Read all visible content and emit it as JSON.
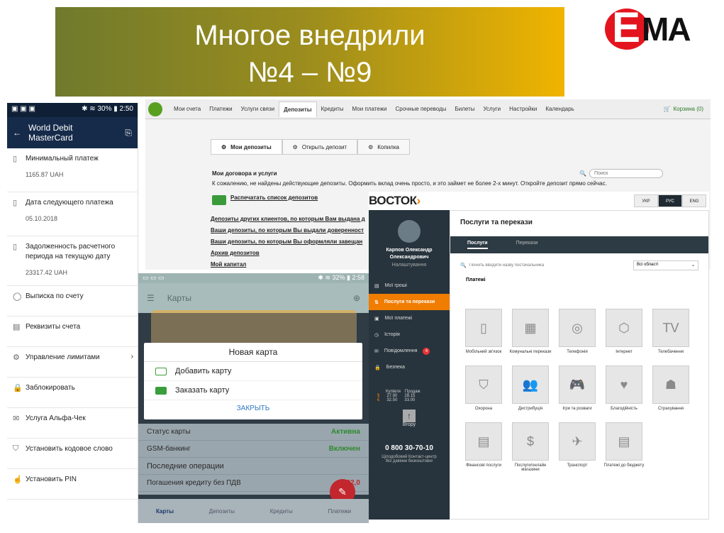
{
  "slide": {
    "title_line1": "Многое внедрили",
    "title_line2": "№4 – №9",
    "logo": "ЕМА"
  },
  "phone1": {
    "status_left": "▣ ▣ ▣",
    "status_right": "✱ ≋ 30% ▮ 2:50",
    "title": "World Debit MasterCard",
    "rows": [
      {
        "label": "Минимальный платеж",
        "value": "1165.87 UAH",
        "icon": "card-icon"
      },
      {
        "label": "Дата следующего платежа",
        "value": "05.10.2018",
        "icon": "card-icon"
      },
      {
        "label": "Задолженность расчетного периода на текущую дату",
        "value": "23317.42 UAH",
        "icon": "card-icon"
      },
      {
        "label": "Выписка по счету",
        "value": "",
        "icon": "circle-icon"
      },
      {
        "label": "Реквизиты счета",
        "value": "",
        "icon": "doc-icon"
      },
      {
        "label": "Управление лимитами",
        "value": "",
        "icon": "limits-icon"
      },
      {
        "label": "Заблокировать",
        "value": "",
        "icon": "lock-icon"
      },
      {
        "label": "Услуга Альфа-Чек",
        "value": "",
        "icon": "mail-icon"
      },
      {
        "label": "Установить кодовое слово",
        "value": "",
        "icon": "shield-icon"
      },
      {
        "label": "Установить PIN",
        "value": "",
        "icon": "hand-icon"
      }
    ]
  },
  "web": {
    "nav": [
      "Мои счета",
      "Платежи",
      "Услуги связи",
      "Депозиты",
      "Кредиты",
      "Мои платежи",
      "Срочные переводы",
      "Билеты",
      "Услуги",
      "Настройки",
      "Календарь"
    ],
    "active_nav": "Депозиты",
    "cart": "Корзина (0)",
    "tabs": [
      "Мои депозиты",
      "Открыть депозит",
      "Копилка"
    ],
    "section": "Мои договора и услуги",
    "search_placeholder": "Поиск",
    "notice": "К сожалению, не найдены действующие депозиты. Оформить вклад очень просто, и это займет не более 2-х минут. Откройте депозит прямо сейчас.",
    "print": "Распечатать список депозитов",
    "links": [
      "Депозиты других клиентов, по которым Вам выдана д",
      "Ваши депозиты, по которым Вы выдали доверенност",
      "Ваши депозиты, по которым Вы оформляли завещан",
      "Архив депозитов",
      "Мой капитал"
    ]
  },
  "vostok": {
    "logo": "ВОСТОК",
    "lang": [
      "УКР",
      "РУС",
      "ENG"
    ],
    "user": "Карпов Олександр Олександрович",
    "settings": "Налаштування",
    "menu": [
      "Мої гроші",
      "Послуги та перекази",
      "Мої платежі",
      "Історія",
      "Повідомлення",
      "Безпека"
    ],
    "badge": "4",
    "rates_head": [
      "Купівля",
      "Продаж"
    ],
    "rates": [
      [
        "$",
        "27.90",
        "28.15"
      ],
      [
        "€",
        "32.50",
        "33.00"
      ]
    ],
    "upload": "Вгору",
    "phone": "0 800 30-70-10",
    "phone_sub": "Цілодобовий Контакт-центр Всі дзвінки безкоштовні",
    "heading": "Послуги та перекази",
    "subtabs": [
      "Послуги",
      "Перекази"
    ],
    "search_placeholder": "Почніть вводити назву постачальника",
    "region": "Всі області",
    "payments": "Платежі",
    "tiles": [
      "Мобільний зв'язок",
      "Комунальні перекази",
      "Телефонія",
      "Інтернет",
      "Телебачення",
      "Охорона",
      "Дистрибуція",
      "Ігри та розваги",
      "Благодійність",
      "Страхування",
      "Фінансові послуги",
      "Послуги/онлайн магазини",
      "Транспорт",
      "Платежі до бюджету"
    ]
  },
  "phone2": {
    "status_right": "✱ ≋ 32% ▮ 2:58",
    "title": "Карты",
    "dialog_title": "Новая карта",
    "opt1": "Добавить карту",
    "opt2": "Заказать карту",
    "close": "ЗАКРЫТЬ",
    "status_label": "Статус карты",
    "status_value": "Активна",
    "gsm_label": "GSM-банкинг",
    "gsm_value": "Включен",
    "ops_title": "Последние операции",
    "op_label": "Погашения кредиту без ПДВ",
    "op_value": "-232,0",
    "nav": [
      "Карты",
      "Депозиты",
      "Кредиты",
      "Платежи"
    ]
  }
}
